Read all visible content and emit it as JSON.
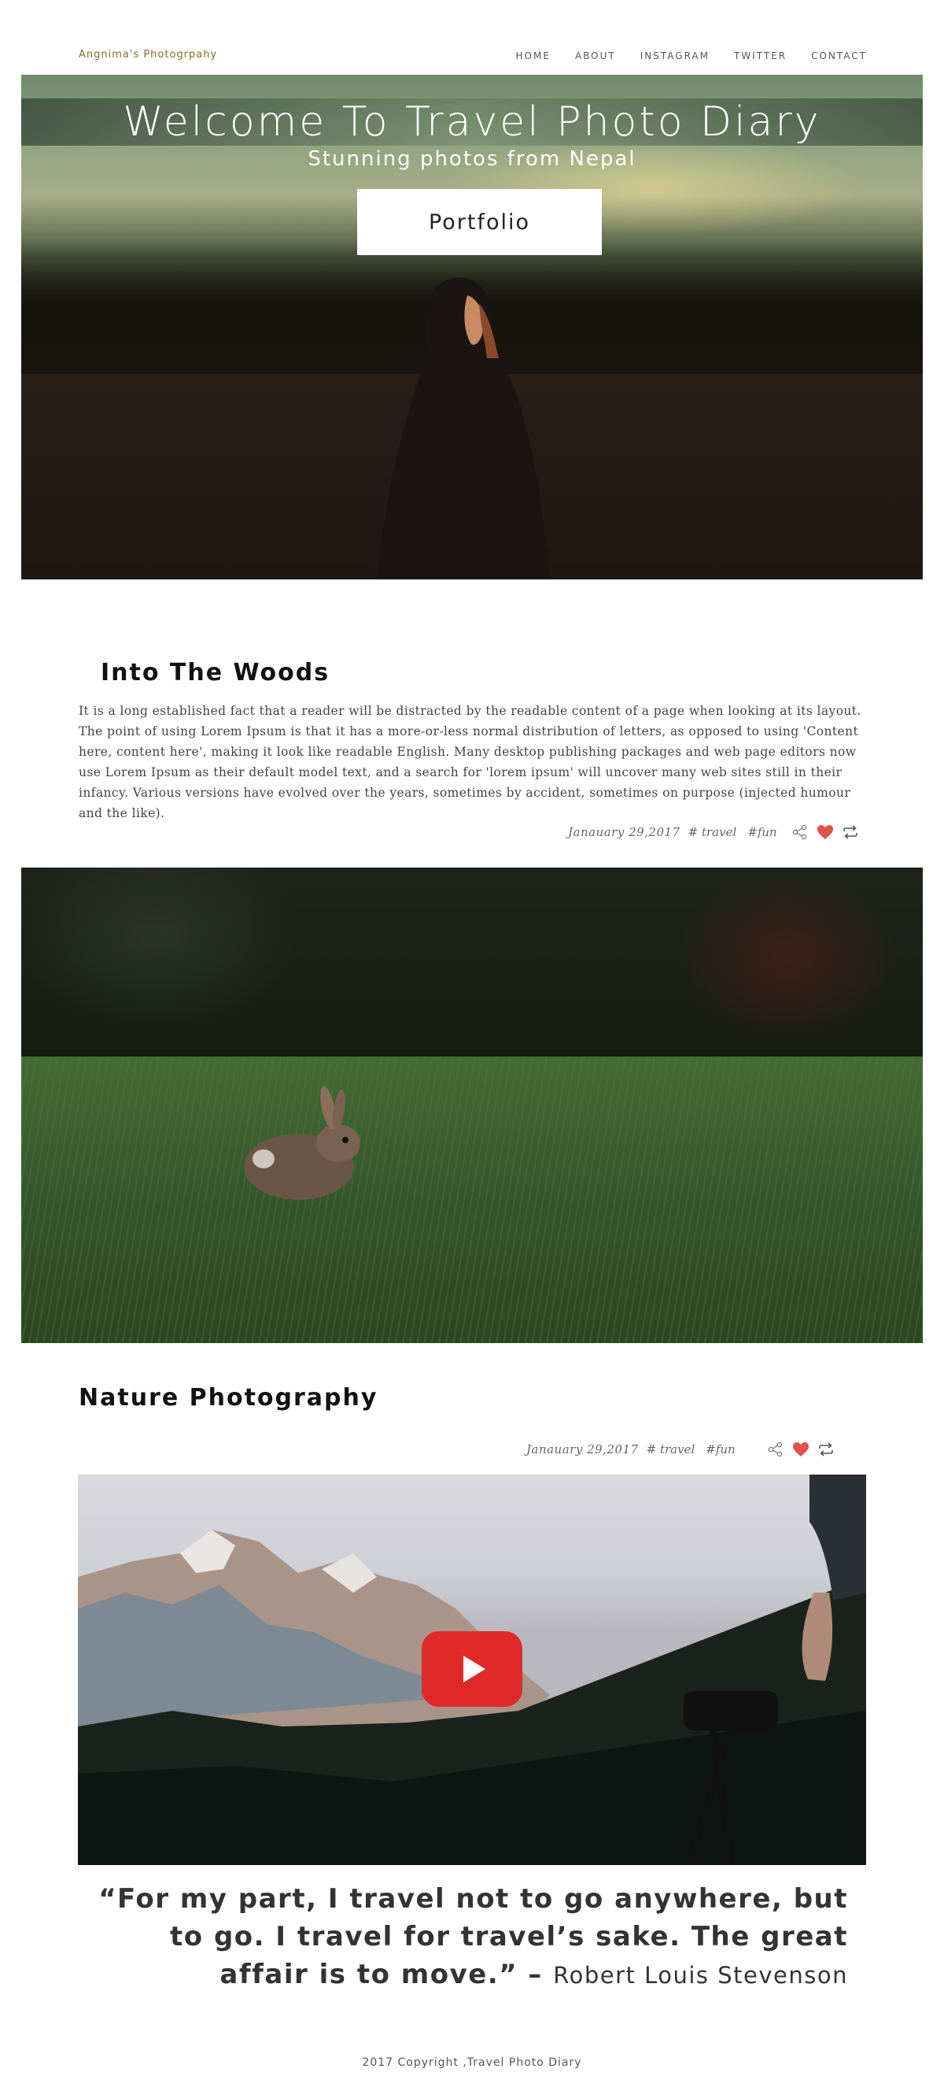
{
  "header": {
    "brand": "Angnima's Photogrpahy",
    "nav": [
      "HOME",
      "ABOUT",
      "INSTAGRAM",
      "TWITTER",
      "CONTACT"
    ]
  },
  "hero": {
    "title": "Welcome To Travel Photo Diary",
    "subtitle": "Stunning photos from Nepal",
    "button_label": "Portfolio"
  },
  "post1": {
    "title": "Into The Woods",
    "body": "It is a long established fact that a reader will be distracted by the readable content of a page when looking at its layout. The point of using Lorem Ipsum is that it has a more-or-less normal distribution of letters, as opposed to using 'Content here, content here', making it look like readable English. Many desktop publishing packages and web page editors now use Lorem Ipsum as their default model text, and a search for 'lorem ipsum' will uncover many web sites still in their infancy. Various versions have evolved over the years, sometimes by accident, sometimes on purpose (injected humour and the like).",
    "date": "Janauary 29,2017",
    "tags": [
      "# travel",
      "#fun"
    ]
  },
  "post2": {
    "title": "Nature Photography",
    "date": "Janauary 29,2017",
    "tags": [
      "# travel",
      "#fun"
    ]
  },
  "quote": {
    "text": "“For my part, I travel not to go anywhere, but to go. I travel for travel’s sake. The great affair is to move.” –",
    "author": "Robert Louis Stevenson"
  },
  "footer": {
    "copyright": "2017 Copyright ,Travel Photo Diary"
  },
  "colors": {
    "brand": "#8a6d1f",
    "heart": "#e0524a",
    "play": "#e02a2a"
  },
  "icons": [
    "share-icon",
    "heart-icon",
    "repost-icon",
    "play-icon"
  ]
}
